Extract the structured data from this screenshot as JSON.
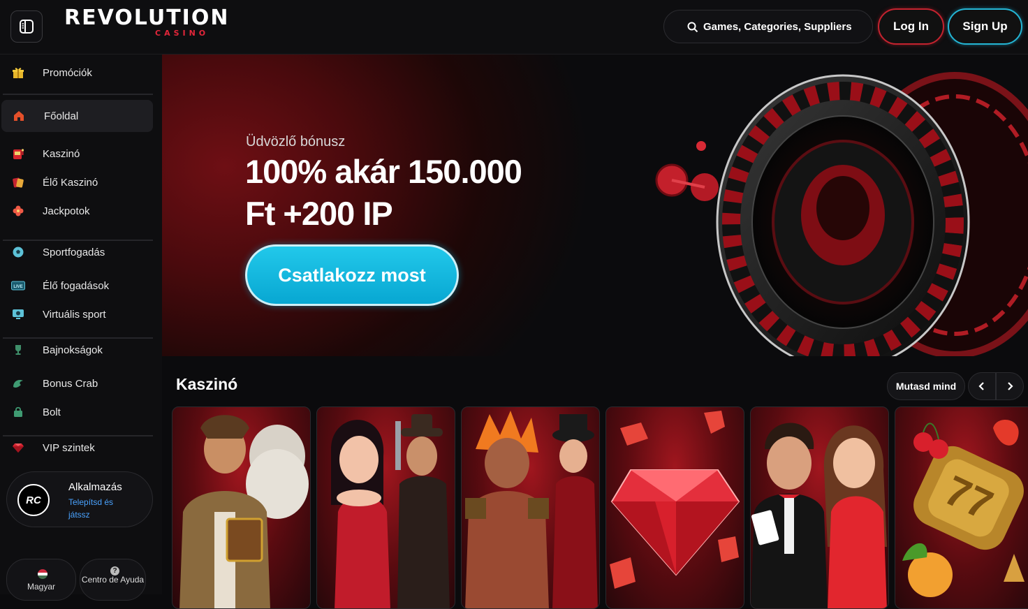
{
  "header": {
    "logo_main": "REVOLUTION",
    "logo_sub": "CASINO",
    "search_placeholder": "Games, Categories, Suppliers",
    "login_label": "Log In",
    "signup_label": "Sign Up"
  },
  "sidebar": {
    "items": [
      {
        "label": "Promóciók",
        "icon": "gift-icon"
      },
      {
        "label": "Főoldal",
        "icon": "home-icon"
      },
      {
        "label": "Kaszinó",
        "icon": "slot-machine-icon"
      },
      {
        "label": "Élő Kaszinó",
        "icon": "live-cards-icon"
      },
      {
        "label": "Jackpotok",
        "icon": "clover-icon"
      },
      {
        "label": "Sportfogadás",
        "icon": "soccer-ball-icon"
      },
      {
        "label": "Élő fogadások",
        "icon": "live-badge-icon"
      },
      {
        "label": "Virtuális sport",
        "icon": "monitor-ball-icon"
      },
      {
        "label": "Bajnokságok",
        "icon": "trophy-icon"
      },
      {
        "label": "Bonus Crab",
        "icon": "crab-claw-icon"
      },
      {
        "label": "Bolt",
        "icon": "shopping-bag-icon"
      },
      {
        "label": "VIP szintek",
        "icon": "diamond-icon"
      }
    ],
    "app": {
      "title": "Alkalmazás",
      "subtitle": "Telepítsd és játssz",
      "logo": "RC"
    },
    "language": "Magyar",
    "help": "Centro de Ayuda"
  },
  "hero": {
    "kicker": "Üdvözlő bónusz",
    "title": "100% akár 150.000 Ft +200 IP",
    "cta": "Csatlakozz most"
  },
  "casino_section": {
    "title": "Kaszinó",
    "show_all": "Mutasd mind"
  },
  "colors": {
    "brand_red": "#e3263a",
    "cta_blue": "#12b8e0",
    "background": "#0b0b0d"
  }
}
